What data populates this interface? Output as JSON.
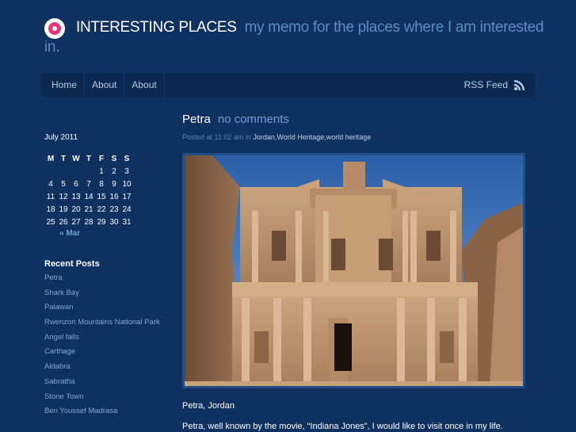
{
  "header": {
    "site_title": "INTERESTING PLACES",
    "site_description": "my memo for the places where I am interested in."
  },
  "nav": {
    "items": [
      {
        "label": "Home"
      },
      {
        "label": "About"
      },
      {
        "label": "About"
      }
    ],
    "rss_label": "RSS Feed",
    "rss_icon": "rss-icon"
  },
  "calendar": {
    "caption": "July 2011",
    "weekdays": [
      "M",
      "T",
      "W",
      "T",
      "F",
      "S",
      "S"
    ],
    "weeks": [
      [
        "",
        "",
        "",
        "",
        "1",
        "2",
        "3"
      ],
      [
        "4",
        "5",
        "6",
        "7",
        "8",
        "9",
        "10"
      ],
      [
        "11",
        "12",
        "13",
        "14",
        "15",
        "16",
        "17"
      ],
      [
        "18",
        "19",
        "20",
        "21",
        "22",
        "23",
        "24"
      ],
      [
        "25",
        "26",
        "27",
        "28",
        "29",
        "30",
        "31"
      ]
    ],
    "prev_label": "« Mar"
  },
  "recent_posts": {
    "title": "Recent Posts",
    "items": [
      "Petra",
      "Shark Bay",
      "Palawan",
      "Rwenzori Mountains National Park",
      "Angel falls",
      "Carthage",
      "Aldabra",
      "Sabratha",
      "Stone Town",
      "Ben Youssef Madrasa"
    ]
  },
  "post": {
    "title": "Petra",
    "comments": "no comments",
    "meta_prefix": "Posted at 11:02 am in",
    "categories": "Jordan,World Heritage,world heritage",
    "caption": "Petra, Jordan",
    "body_partial": "Petra, well known by the movie, “Indiana Jones”, I would like to visit once in my life."
  },
  "colors": {
    "background": "#0e3160",
    "nav_background": "#0a2850",
    "link": "#7ea9d6",
    "accent": "#e8357a"
  }
}
